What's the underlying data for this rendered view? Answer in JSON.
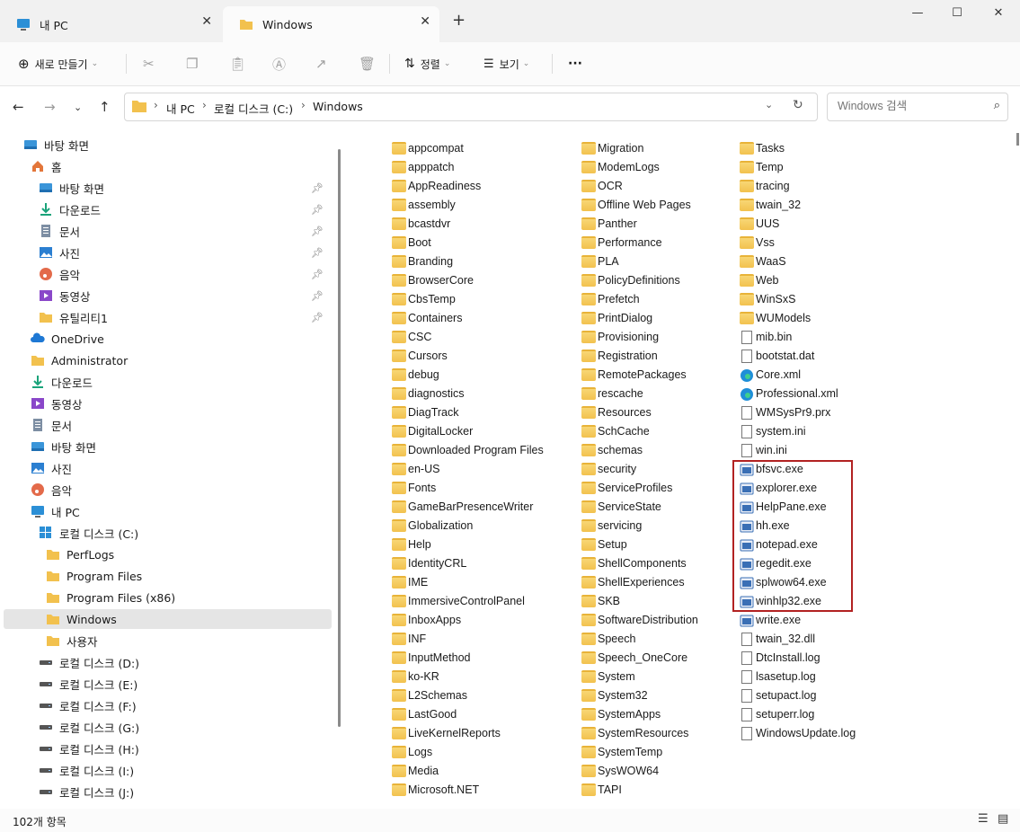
{
  "tabs": [
    {
      "label": "내 PC",
      "icon": "computer-icon"
    },
    {
      "label": "Windows",
      "icon": "folder-icon"
    }
  ],
  "toolbar": {
    "new_label": "새로 만들기",
    "sort_label": "정렬",
    "view_label": "보기",
    "more_label": "···"
  },
  "address": {
    "crumbs": [
      "내 PC",
      "로컬 디스크 (C:)",
      "Windows"
    ],
    "search_placeholder": "Windows 검색"
  },
  "sidebar": {
    "items": [
      {
        "label": "바탕 화면",
        "icon": "desktop-icon",
        "pinned": false
      },
      {
        "label": "홈",
        "icon": "home-icon",
        "pinned": false
      },
      {
        "label": "바탕 화면",
        "icon": "desktop-icon",
        "pinned": true
      },
      {
        "label": "다운로드",
        "icon": "download-icon",
        "pinned": true
      },
      {
        "label": "문서",
        "icon": "document-icon",
        "pinned": true
      },
      {
        "label": "사진",
        "icon": "picture-icon",
        "pinned": true
      },
      {
        "label": "음악",
        "icon": "music-icon",
        "pinned": true
      },
      {
        "label": "동영상",
        "icon": "video-icon",
        "pinned": true
      },
      {
        "label": "유틸리티1",
        "icon": "folder-icon",
        "pinned": true
      },
      {
        "label": "OneDrive",
        "icon": "onedrive-icon",
        "pinned": false
      },
      {
        "label": "Administrator",
        "icon": "folder-icon",
        "pinned": false
      },
      {
        "label": "다운로드",
        "icon": "download-icon",
        "pinned": false
      },
      {
        "label": "동영상",
        "icon": "video-icon",
        "pinned": false
      },
      {
        "label": "문서",
        "icon": "document-icon",
        "pinned": false
      },
      {
        "label": "바탕 화면",
        "icon": "desktop-icon",
        "pinned": false
      },
      {
        "label": "사진",
        "icon": "picture-icon",
        "pinned": false
      },
      {
        "label": "음악",
        "icon": "music-icon",
        "pinned": false
      },
      {
        "label": "내 PC",
        "icon": "computer-icon",
        "pinned": false
      },
      {
        "label": "로컬 디스크 (C:)",
        "icon": "windows-drive-icon",
        "pinned": false
      },
      {
        "label": "PerfLogs",
        "icon": "folder-icon",
        "pinned": false
      },
      {
        "label": "Program Files",
        "icon": "folder-icon",
        "pinned": false
      },
      {
        "label": "Program Files (x86)",
        "icon": "folder-icon",
        "pinned": false
      },
      {
        "label": "Windows",
        "icon": "folder-icon",
        "pinned": false,
        "selected": true
      },
      {
        "label": "사용자",
        "icon": "folder-icon",
        "pinned": false
      },
      {
        "label": "로컬 디스크 (D:)",
        "icon": "drive-icon",
        "pinned": false
      },
      {
        "label": "로컬 디스크 (E:)",
        "icon": "drive-icon",
        "pinned": false
      },
      {
        "label": "로컬 디스크 (F:)",
        "icon": "drive-icon",
        "pinned": false
      },
      {
        "label": "로컬 디스크 (G:)",
        "icon": "drive-icon",
        "pinned": false
      },
      {
        "label": "로컬 디스크 (H:)",
        "icon": "drive-icon",
        "pinned": false
      },
      {
        "label": "로컬 디스크 (I:)",
        "icon": "drive-icon",
        "pinned": false
      },
      {
        "label": "로컬 디스크 (J:)",
        "icon": "drive-icon",
        "pinned": false
      }
    ]
  },
  "files": {
    "col1": [
      "appcompat",
      "apppatch",
      "AppReadiness",
      "assembly",
      "bcastdvr",
      "Boot",
      "Branding",
      "BrowserCore",
      "CbsTemp",
      "Containers",
      "CSC",
      "Cursors",
      "debug",
      "diagnostics",
      "DiagTrack",
      "DigitalLocker",
      "Downloaded Program Files",
      "en-US",
      "Fonts",
      "GameBarPresenceWriter",
      "Globalization",
      "Help",
      "IdentityCRL",
      "IME",
      "ImmersiveControlPanel",
      "InboxApps",
      "INF",
      "InputMethod",
      "ko-KR",
      "L2Schemas",
      "LastGood",
      "LiveKernelReports",
      "Logs",
      "Media",
      "Microsoft.NET"
    ],
    "col2": [
      "Migration",
      "ModemLogs",
      "OCR",
      "Offline Web Pages",
      "Panther",
      "Performance",
      "PLA",
      "PolicyDefinitions",
      "Prefetch",
      "PrintDialog",
      "Provisioning",
      "Registration",
      "RemotePackages",
      "rescache",
      "Resources",
      "SchCache",
      "schemas",
      "security",
      "ServiceProfiles",
      "ServiceState",
      "servicing",
      "Setup",
      "ShellComponents",
      "ShellExperiences",
      "SKB",
      "SoftwareDistribution",
      "Speech",
      "Speech_OneCore",
      "System",
      "System32",
      "SystemApps",
      "SystemResources",
      "SystemTemp",
      "SysWOW64",
      "TAPI"
    ],
    "col3": [
      "Tasks",
      "Temp",
      "tracing",
      "twain_32",
      "UUS",
      "Vss",
      "WaaS",
      "Web",
      "WinSxS",
      "WUModels",
      "mib.bin",
      "bootstat.dat",
      "Core.xml",
      "Professional.xml",
      "WMSysPr9.prx",
      "system.ini",
      "win.ini",
      "bfsvc.exe",
      "explorer.exe",
      "HelpPane.exe",
      "hh.exe",
      "notepad.exe",
      "regedit.exe",
      "splwow64.exe",
      "winhlp32.exe",
      "write.exe",
      "twain_32.dll",
      "DtcInstall.log",
      "lsasetup.log",
      "setupact.log",
      "setuperr.log",
      "WindowsUpdate.log"
    ],
    "col3_types": [
      "folder",
      "folder",
      "folder",
      "folder",
      "folder",
      "folder",
      "folder",
      "folder",
      "folder",
      "folder",
      "file",
      "file",
      "edge",
      "edge",
      "file",
      "ini",
      "ini",
      "exe",
      "exe",
      "exe",
      "exe",
      "exe",
      "exe",
      "exe",
      "exe",
      "exe",
      "dll",
      "log",
      "log",
      "log",
      "log",
      "log"
    ]
  },
  "status": {
    "count": "102개 항목"
  },
  "colors": {
    "highlight": "#b22222",
    "folder": "#f2c14e"
  }
}
